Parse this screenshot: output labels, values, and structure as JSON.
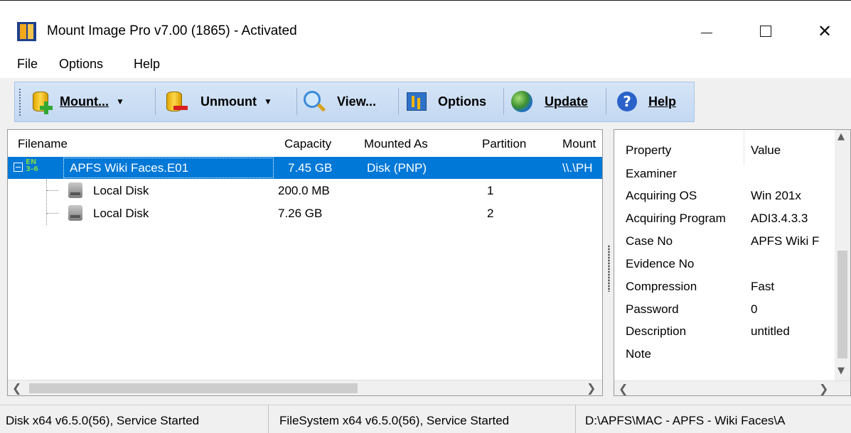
{
  "window": {
    "title": "Mount Image Pro v7.00 (1865) - Activated",
    "controls": {
      "minimize": "",
      "maximize": "",
      "close": "✕"
    }
  },
  "menu": [
    "File",
    "Options",
    "Help"
  ],
  "toolbar": {
    "mount_label": "Mount...",
    "unmount_label": "Unmount",
    "view_label": "View...",
    "options_label": "Options",
    "update_label": "Update",
    "help_label": "Help"
  },
  "mounted_list": {
    "columns": [
      "Filename",
      "Capacity",
      "Mounted As",
      "Partition",
      "Mount"
    ],
    "rows": [
      {
        "filename": "APFS Wiki Faces.E01",
        "capacity": "7.45 GB",
        "mounted_as": "Disk (PNP)",
        "partition": "",
        "mount": "\\\\.\\PH",
        "selected": true,
        "icon_text": "EN 3-6"
      },
      {
        "filename": "Local Disk",
        "capacity": "200.0 MB",
        "mounted_as": "",
        "partition": "1",
        "mount": ""
      },
      {
        "filename": "Local Disk",
        "capacity": "7.26 GB",
        "mounted_as": "",
        "partition": "2",
        "mount": ""
      }
    ]
  },
  "properties": {
    "columns": [
      "Property",
      "Value"
    ],
    "rows": [
      {
        "property": "Examiner",
        "value": ""
      },
      {
        "property": "Acquiring OS",
        "value": "Win 201x"
      },
      {
        "property": "Acquiring Program",
        "value": "ADI3.4.3.3"
      },
      {
        "property": "Case No",
        "value": "APFS Wiki F"
      },
      {
        "property": "Evidence No",
        "value": ""
      },
      {
        "property": "Compression",
        "value": "Fast"
      },
      {
        "property": "Password",
        "value": "0"
      },
      {
        "property": "Description",
        "value": "untitled"
      },
      {
        "property": "Note",
        "value": ""
      }
    ]
  },
  "status": {
    "disk": "Disk x64 v6.5.0(56), Service Started",
    "filesystem": "FileSystem x64 v6.5.0(56), Service Started",
    "path": "D:\\APFS\\MAC - APFS - Wiki Faces\\A"
  },
  "colors": {
    "selection": "#0078d7",
    "toolbar_band": "#c3d8f2"
  },
  "icons": {
    "app": "mount-image-pro-icon",
    "mount": "database-add-icon",
    "unmount": "database-remove-icon",
    "view": "magnifier-icon",
    "options": "options-icon",
    "update": "globe-update-icon",
    "help": "help-icon"
  }
}
